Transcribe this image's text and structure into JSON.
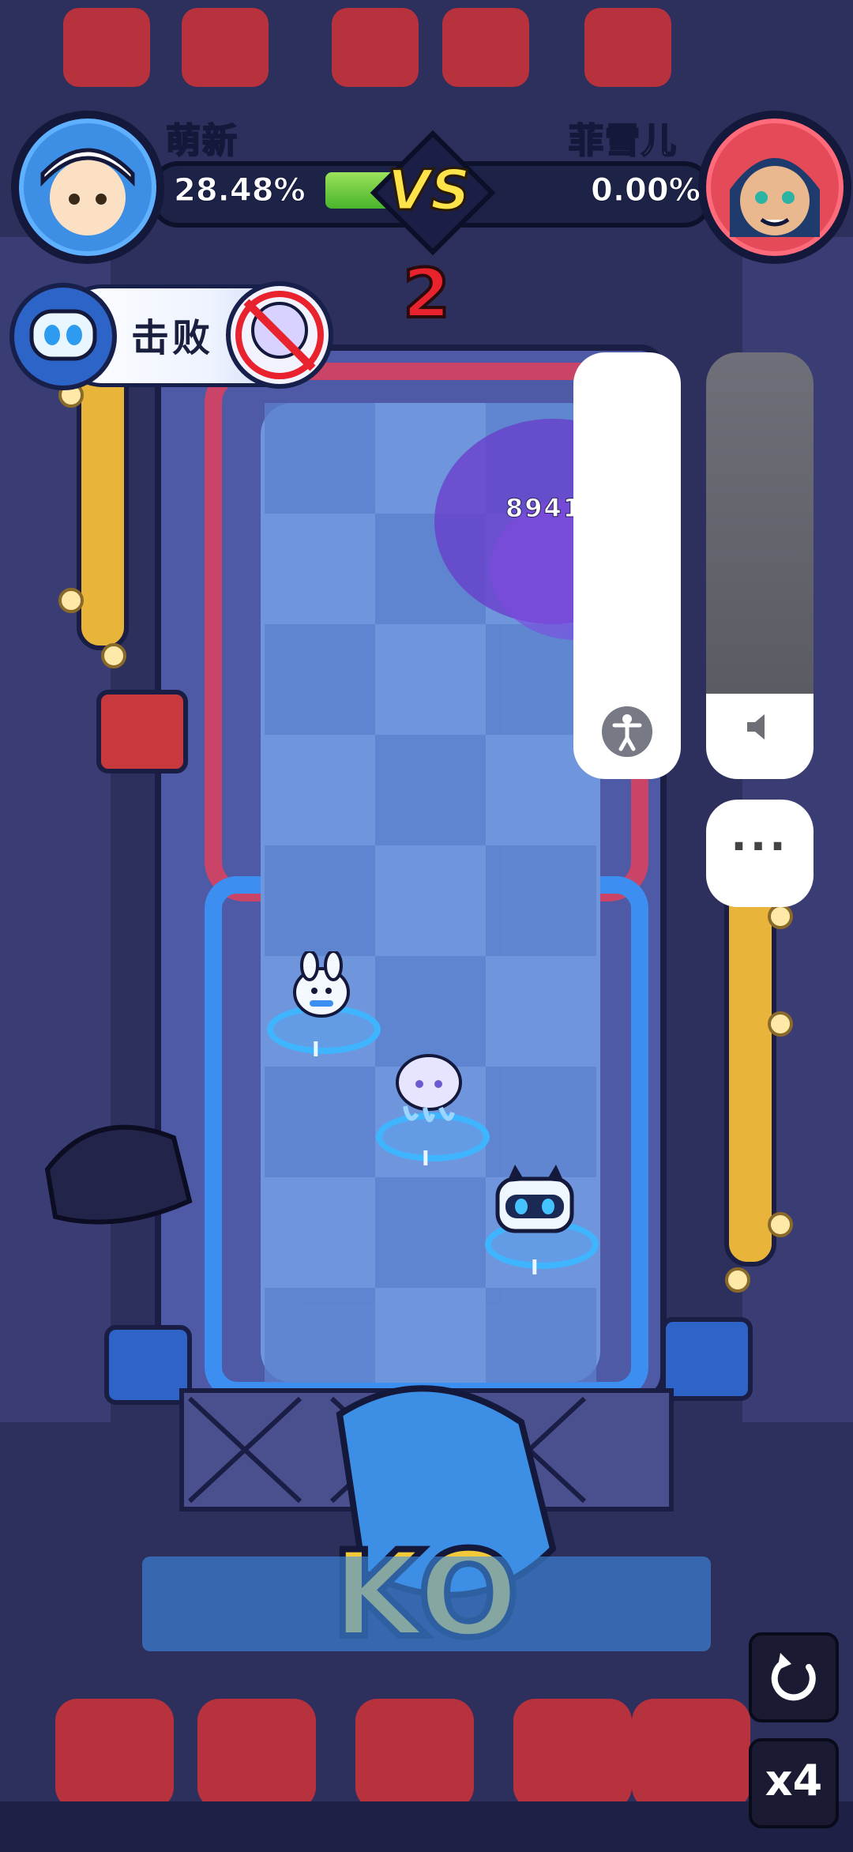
{
  "players": {
    "left": {
      "name": "萌新",
      "percent": "28.48%"
    },
    "right": {
      "name": "菲雪儿",
      "percent": "0.00%"
    },
    "versus": "VS",
    "progress_fraction": 0.12
  },
  "round_counter": "2",
  "defeat_banner": {
    "label": "击败"
  },
  "damage_text": "8941 2",
  "overlay": {
    "accessibility_icon": "accessibility-icon",
    "volume_icon": "speaker-icon",
    "more_label": "···"
  },
  "controls": {
    "replay_icon": "replay-icon",
    "speed_label": "x4"
  },
  "characters": [
    {
      "name": "bunny-hero",
      "tag": "I"
    },
    {
      "name": "jellyfish-hero",
      "tag": "I"
    },
    {
      "name": "robot-cat-hero",
      "tag": "I"
    }
  ],
  "colors": {
    "team_left": "#3d8fe6",
    "team_right": "#e44a58",
    "vs": "#ffe34a",
    "counter": "#e8232e",
    "ring": "#3fb5ff"
  }
}
